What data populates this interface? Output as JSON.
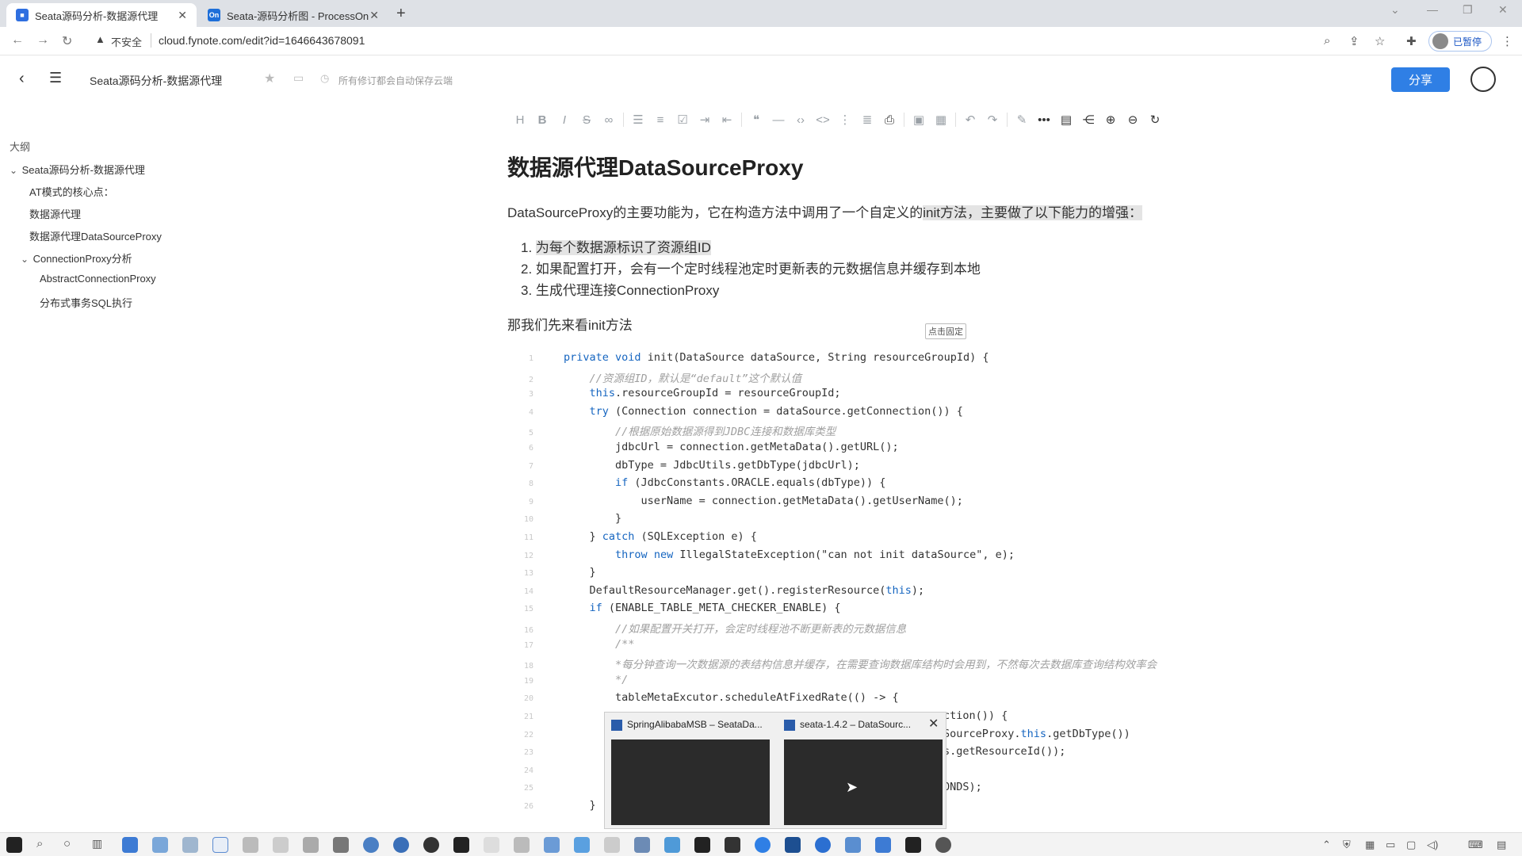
{
  "browser": {
    "tabs": [
      {
        "label": "Seata源码分析-数据源代理",
        "favicon": "fynote-icon",
        "active": true
      },
      {
        "label": "Seata-源码分析图 - ProcessOn",
        "favicon": "processon-icon",
        "active": false
      }
    ],
    "security_label": "不安全",
    "url": "cloud.fynote.com/edit?id=1646643678091",
    "profile_label": "已暂停"
  },
  "app": {
    "doc_title": "Seata源码分析-数据源代理",
    "save_status": "所有修订都会自动保存云端",
    "share_label": "分享"
  },
  "outline": {
    "title": "大纲",
    "items": [
      {
        "label": "Seata源码分析-数据源代理",
        "level": 0,
        "expanded": true
      },
      {
        "label": "AT模式的核心点：",
        "level": 1
      },
      {
        "label": "数据源代理",
        "level": 1
      },
      {
        "label": "数据源代理DataSourceProxy",
        "level": 1
      },
      {
        "label": "ConnectionProxy分析",
        "level": 1,
        "expanded": true
      },
      {
        "label": "AbstractConnectionProxy",
        "level": 2
      },
      {
        "label": "分布式事务SQL执行",
        "level": 2
      }
    ]
  },
  "document": {
    "heading": "数据源代理DataSourceProxy",
    "intro_a": "DataSourceProxy的主要功能为，它在构造方法中调用了一个自定义的",
    "intro_b": "init方法，主要做了以下能力的增强：",
    "list": [
      "为每个数据源标识了资源组ID",
      "如果配置打开，会有一个定时线程池定时更新表的元数据信息并缓存到本地",
      "生成代理连接ConnectionProxy"
    ],
    "list_numbers": [
      "1.",
      "2.",
      "3."
    ],
    "followup": "那我们先来看init方法",
    "pin_label": "点击固定"
  },
  "code": {
    "line_numbers": [
      "1",
      "2",
      "3",
      "4",
      "5",
      "6",
      "7",
      "8",
      "9",
      "10",
      "11",
      "12",
      "13",
      "14",
      "15",
      "16",
      "17",
      "18",
      "19",
      "20",
      "21",
      "22",
      "23",
      "24",
      "25",
      "26"
    ],
    "lines": [
      "private void init(DataSource dataSource, String resourceGroupId) {",
      "    //资源组ID，默认是“default”这个默认值",
      "    this.resourceGroupId = resourceGroupId;",
      "    try (Connection connection = dataSource.getConnection()) {",
      "        //根据原始数据源得到JDBC连接和数据库类型",
      "        jdbcUrl = connection.getMetaData().getURL();",
      "        dbType = JdbcUtils.getDbType(jdbcUrl);",
      "        if (JdbcConstants.ORACLE.equals(dbType)) {",
      "            userName = connection.getMetaData().getUserName();",
      "        }",
      "    } catch (SQLException e) {",
      "        throw new IllegalStateException(\"can not init dataSource\", e);",
      "    }",
      "    DefaultResourceManager.get().registerResource(this);",
      "    if (ENABLE_TABLE_META_CHECKER_ENABLE) {",
      "        //如果配置开关打开，会定时线程池不断更新表的元数据信息",
      "        /**",
      "        *每分钟查询一次数据源的表结构信息并缓存，在需要查询数据库结构时会用到，不然每次去数据库查询结构效率会",
      "        */",
      "        tableMetaExcutor.scheduleAtFixedRate(() -> {",
      "ction()) {",
      "SourceProxy.this.getDbType())",
      "s.getResourceId());",
      "",
      "ONDS);",
      "    }"
    ]
  },
  "taskbar_preview": {
    "windows": [
      {
        "title": "SpringAlibabaMSB – SeataDa...",
        "icon": "intellij-icon"
      },
      {
        "title": "seata-1.4.2 – DataSourc...",
        "icon": "intellij-icon"
      }
    ]
  },
  "colors": {
    "accent": "#2f7fe5",
    "keyword": "#1565c0",
    "comment": "#a0a0a0",
    "highlight": "#e4e4e4"
  }
}
